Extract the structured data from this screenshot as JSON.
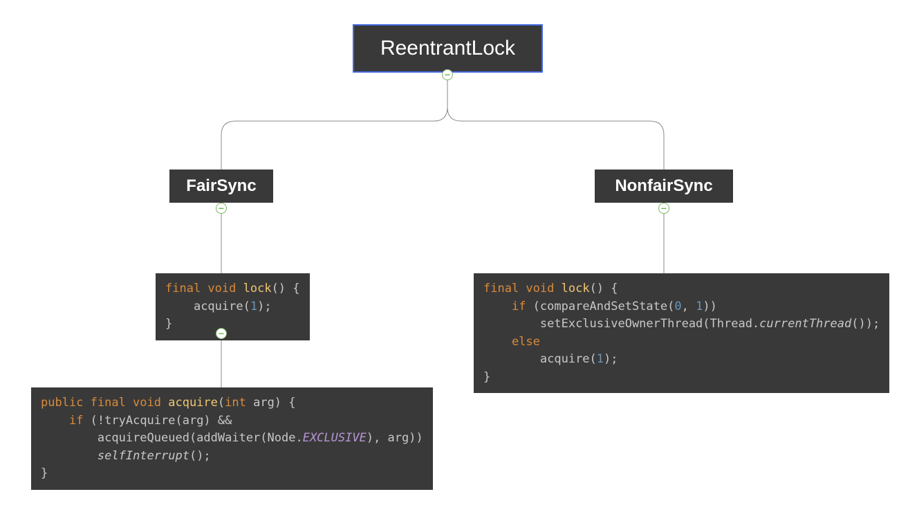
{
  "root": {
    "title": "ReentrantLock"
  },
  "left": {
    "title": "FairSync",
    "code1": {
      "l1_kw": "final void",
      "l1_fn": "lock",
      "l1_tail": "() {",
      "l2_indent": "    ",
      "l2_text": "acquire(",
      "l2_num": "1",
      "l2_tail": ");",
      "l3": "}"
    },
    "code2": {
      "l1_kw": "public final void",
      "l1_fn": " acquire",
      "l1_p": "(",
      "l1_kw2": "int",
      "l1_arg": " arg) {",
      "l2_indent": "    ",
      "l2_kw": "if",
      "l2_text": " (!tryAcquire(arg) &&",
      "l3_indent": "        ",
      "l3_text": "acquireQueued(addWaiter(Node.",
      "l3_const": "EXCLUSIVE",
      "l3_tail": "), arg))",
      "l4_indent": "        ",
      "l4_fn": "selfInterrupt",
      "l4_tail": "();",
      "l5": "}"
    }
  },
  "right": {
    "title": "NonfairSync",
    "code1": {
      "l1_kw": "final void",
      "l1_fn": "lock",
      "l1_tail": "() {",
      "l2_indent": "    ",
      "l2_kw": "if",
      "l2_text": " (compareAndSetState(",
      "l2_n1": "0",
      "l2_c": ", ",
      "l2_n2": "1",
      "l2_tail": "))",
      "l3_indent": "        ",
      "l3_text": "setExclusiveOwnerThread(Thread.",
      "l3_fn": "currentThread",
      "l3_tail": "());",
      "l4_indent": "    ",
      "l4_kw": "else",
      "l5_indent": "        ",
      "l5_text": "acquire(",
      "l5_num": "1",
      "l5_tail": ");",
      "l6": "}"
    }
  }
}
